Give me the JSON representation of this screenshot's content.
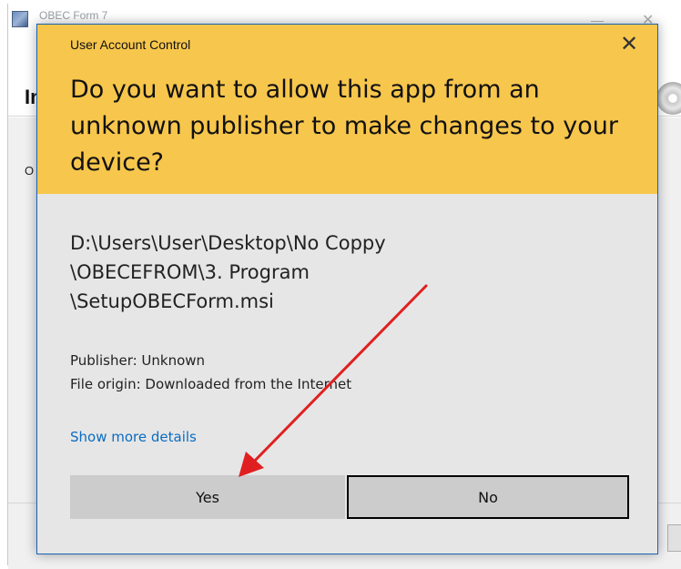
{
  "background_window": {
    "title": "OBEC Form 7",
    "heading": "In",
    "body_text": "O"
  },
  "uac": {
    "caption": "User Account Control",
    "close_symbol": "✕",
    "question": "Do you want to allow this app from an unknown publisher to make changes to your device?",
    "path_lines": [
      "D:\\Users\\User\\Desktop\\No Coppy",
      "\\OBECEFROM\\3. Program",
      "\\SetupOBECForm.msi"
    ],
    "publisher": "Publisher: Unknown",
    "file_origin": "File origin: Downloaded from the Internet",
    "more_details": "Show more details",
    "yes_label": "Yes",
    "no_label": "No"
  },
  "colors": {
    "header_bg": "#f7c64c",
    "dialog_bg": "#e6e6e6",
    "link": "#0a6cc2",
    "annotation_arrow": "#e02020"
  }
}
